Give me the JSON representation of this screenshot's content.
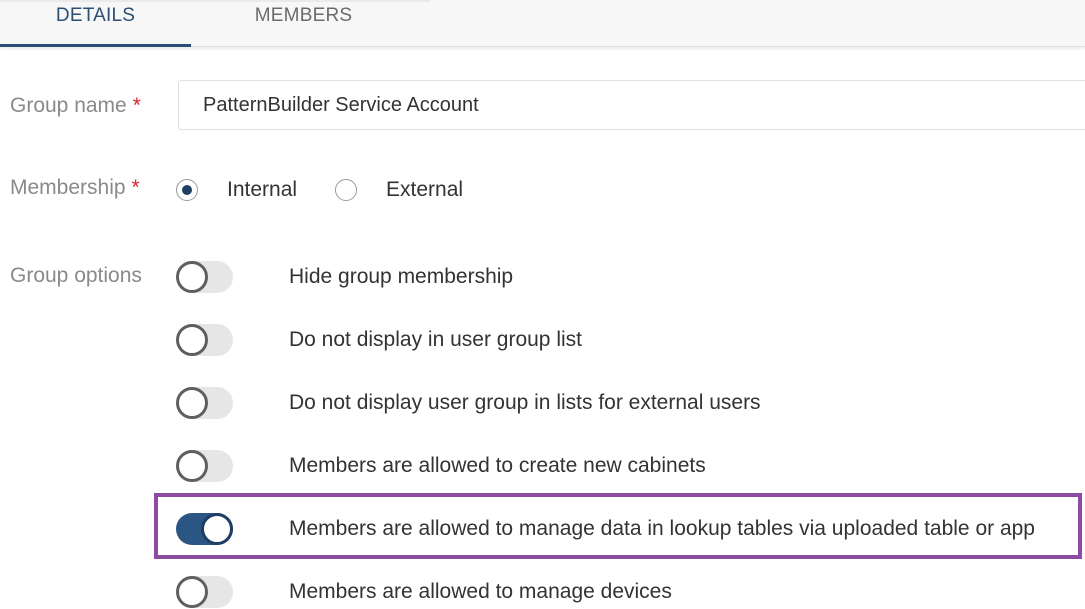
{
  "tabs": [
    {
      "label": "DETAILS"
    },
    {
      "label": "MEMBERS"
    }
  ],
  "fields": {
    "group_name": {
      "label": "Group name",
      "required_mark": "*",
      "value": "PatternBuilder Service Account"
    },
    "membership": {
      "label": "Membership",
      "required_mark": "*",
      "options": [
        {
          "label": "Internal",
          "selected": true
        },
        {
          "label": "External",
          "selected": false
        }
      ]
    },
    "group_options": {
      "label": "Group options",
      "items": [
        {
          "label": "Hide group membership",
          "enabled": false
        },
        {
          "label": "Do not display in user group list",
          "enabled": false
        },
        {
          "label": "Do not display user group in lists for external users",
          "enabled": false
        },
        {
          "label": "Members are allowed to create new cabinets",
          "enabled": false
        },
        {
          "label": "Members are allowed to manage data in lookup tables via uploaded table or app",
          "enabled": true,
          "highlighted": true
        },
        {
          "label": "Members are allowed to manage devices",
          "enabled": false
        }
      ]
    }
  },
  "colors": {
    "accent": "#2b4f74",
    "toggle_on": "#2b5583",
    "required": "#d9232e",
    "highlight": "#8c4ca3"
  }
}
